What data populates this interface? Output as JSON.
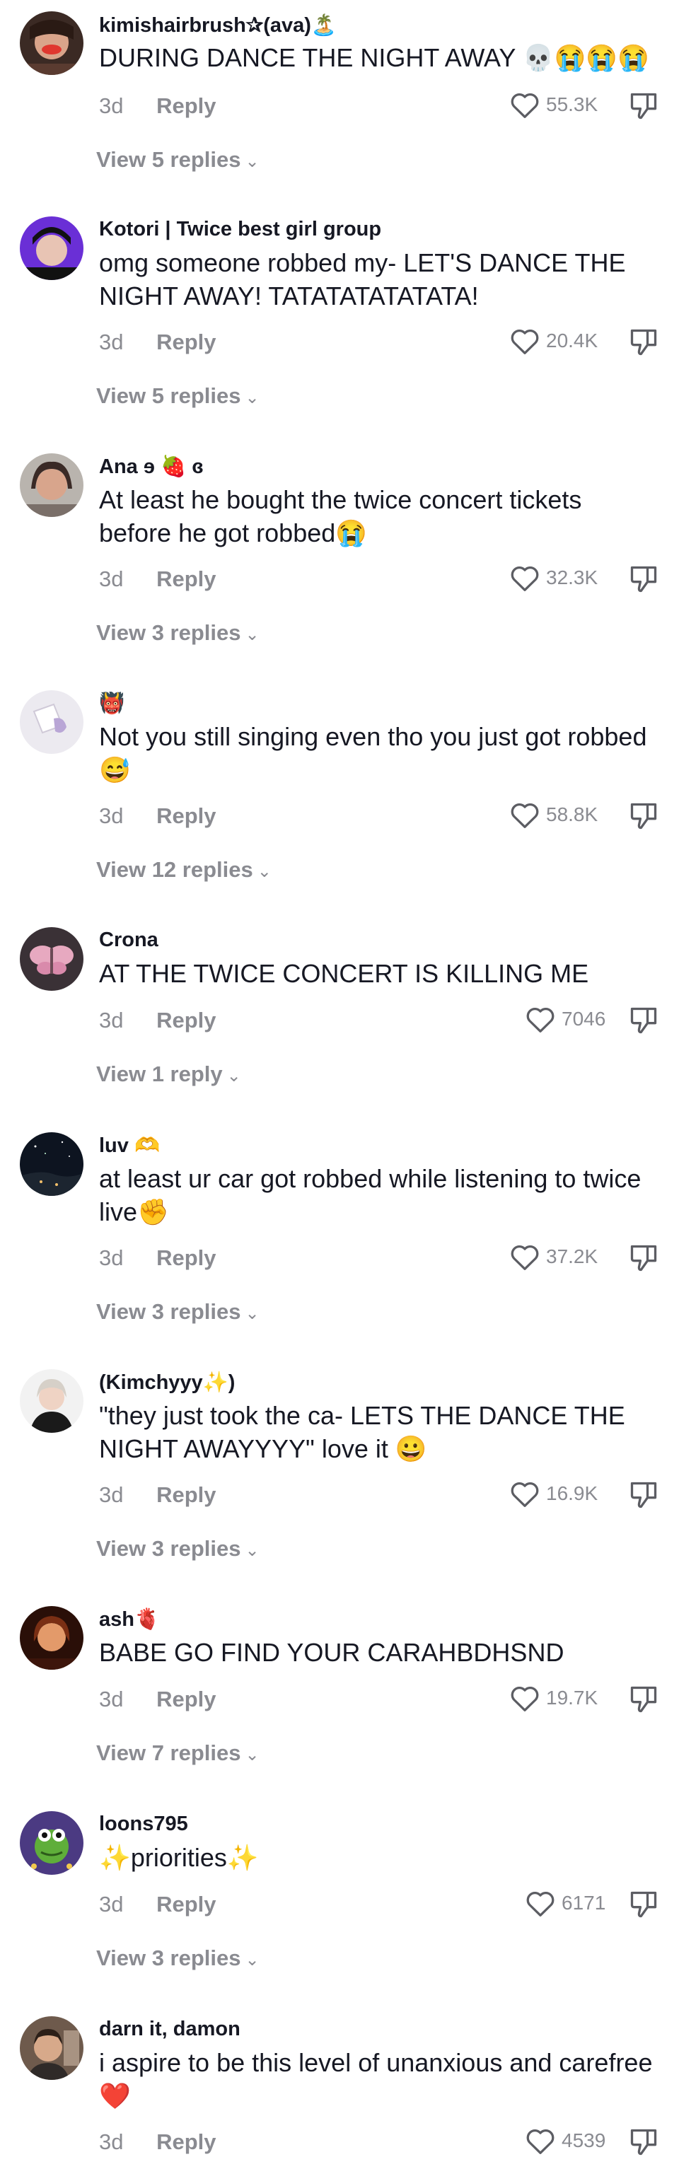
{
  "colors": {
    "text": "#161823",
    "muted": "#8a8b91",
    "heart_red": "#fe2c55"
  },
  "icons": {
    "like": "heart-outline-icon",
    "dislike": "thumbs-down-icon",
    "chevron": "chevron-down-icon"
  },
  "labels": {
    "reply": "Reply"
  },
  "comments": [
    {
      "username": "kimishairbrush✰(ava)🏝️",
      "text": "DURING DANCE THE NIGHT AWAY 💀😭😭😭",
      "age": "3d",
      "likes": "55.3K",
      "view_replies": "View 5 replies"
    },
    {
      "username": "Kotori | Twice best girl group",
      "text": "omg someone robbed my- LET'S DANCE THE NIGHT AWAY! TATATATATATATA!",
      "age": "3d",
      "likes": "20.4K",
      "view_replies": "View 5 replies"
    },
    {
      "username": "Ana ɘ 🍓 ɞ",
      "text": "At least he bought the twice concert tickets before he got robbed😭",
      "age": "3d",
      "likes": "32.3K",
      "view_replies": "View 3 replies"
    },
    {
      "username": "👹",
      "text": "Not you still singing even tho you just got robbed 😅",
      "age": "3d",
      "likes": "58.8K",
      "view_replies": "View 12 replies"
    },
    {
      "username": "Crona",
      "text": "AT THE TWICE CONCERT IS KILLING ME",
      "age": "3d",
      "likes": "7046",
      "view_replies": "View 1 reply"
    },
    {
      "username": "luv 🫶",
      "text": "at least ur car got robbed while listening to twice live✊",
      "age": "3d",
      "likes": "37.2K",
      "view_replies": "View 3 replies"
    },
    {
      "username": "(Kimchyyy✨)",
      "text": "\"they just took the ca- LETS THE DANCE THE NIGHT AWAYYYY\" love it 😀",
      "age": "3d",
      "likes": "16.9K",
      "view_replies": "View 3 replies"
    },
    {
      "username": "ash🫀",
      "text": "BABE GO FIND YOUR CARAHBDHSND",
      "age": "3d",
      "likes": "19.7K",
      "view_replies": "View 7 replies"
    },
    {
      "username": "loons795",
      "text": "✨priorities✨",
      "age": "3d",
      "likes": "6171",
      "view_replies": "View 3 replies"
    },
    {
      "username": "darn it, damon",
      "text": "i aspire to be this level of unanxious and carefree ❤️",
      "age": "3d",
      "likes": "4539",
      "view_replies": ""
    }
  ]
}
